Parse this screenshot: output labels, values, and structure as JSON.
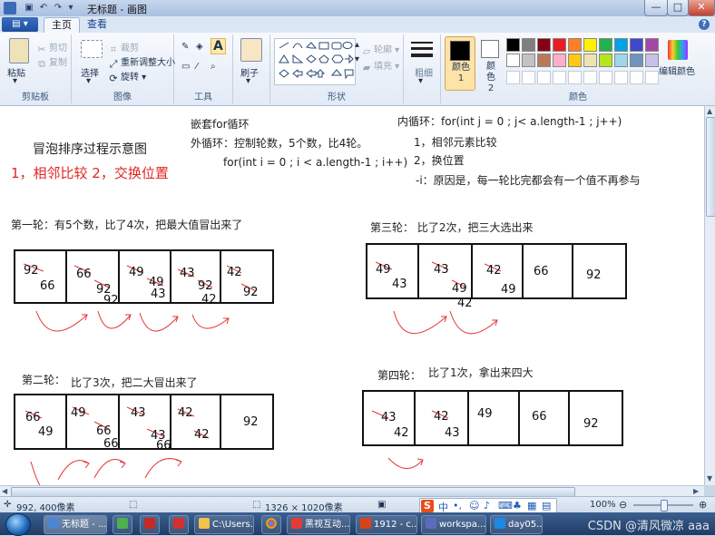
{
  "window": {
    "title": "无标题 - 画图",
    "controls": {
      "minimize": "—",
      "maximize": "□",
      "close": "✕"
    }
  },
  "tabs": [
    {
      "label": "主页",
      "active": true
    },
    {
      "label": "查看",
      "active": false
    }
  ],
  "ribbon": {
    "clipboard": {
      "label": "剪贴板",
      "paste": "粘贴",
      "cut": "剪切",
      "copy": "复制"
    },
    "image": {
      "label": "图像",
      "select": "选择",
      "crop": "裁剪",
      "resize": "重新调整大小",
      "rotate": "旋转"
    },
    "tools": {
      "label": "工具"
    },
    "brushes": {
      "label": "刷子"
    },
    "shapes": {
      "label": "形状",
      "outline": "轮廓",
      "fill": "填充"
    },
    "size": {
      "label": "粗细"
    },
    "colors": {
      "label": "颜色",
      "color1": "颜色 1",
      "color2": "颜色 2",
      "edit": "编辑颜色",
      "palette_row1": [
        "#000000",
        "#7f7f7f",
        "#880015",
        "#ed1c24",
        "#ff7f27",
        "#fff200",
        "#22b14c",
        "#00a2e8",
        "#3f48cc",
        "#a349a4"
      ],
      "palette_row2": [
        "#ffffff",
        "#c3c3c3",
        "#b97a57",
        "#ffaec9",
        "#ffc90e",
        "#efe4b0",
        "#b5e61d",
        "#99d9ea",
        "#7092be",
        "#c8bfe7"
      ]
    }
  },
  "canvas": {
    "title": "冒泡排序过程示意图",
    "subtitle": "1，相邻比较 2，交换位置",
    "nested": {
      "head": "嵌套for循环",
      "outer": "外循环：控制轮数，5个数，比4轮。",
      "outer_code": "for(int i = 0 ; i < a.length-1 ; i++)"
    },
    "inner": {
      "code": "内循环：for(int j = 0 ; j< a.length-1 ; j++)",
      "step1": "1，相邻元素比较",
      "step2": "2，换位置",
      "note": "-i：原因是，每一轮比完都会有一个值不再参与"
    },
    "rounds": {
      "r1": {
        "label": "第一轮：有5个数，比了4次，把最大值冒出来了",
        "nums": [
          "92",
          "66",
          "66",
          "92",
          "49",
          "49",
          "92",
          "43",
          "43",
          "92",
          "42",
          "42",
          "92"
        ]
      },
      "r2": {
        "label_a": "第二轮：",
        "label_b": "比了3次，把二大冒出来了",
        "nums": [
          "66",
          "49",
          "49",
          "66",
          "43",
          "43",
          "66",
          "42",
          "42",
          "66",
          "92"
        ]
      },
      "r3": {
        "label": "第三轮：  比了2次，把三大选出来",
        "nums": [
          "49",
          "43",
          "43",
          "49",
          "42",
          "42",
          "49",
          "66",
          "92"
        ]
      },
      "r4": {
        "label_a": "第四轮：",
        "label_b": "比了1次，拿出来四大",
        "nums": [
          "43",
          "42",
          "42",
          "43",
          "49",
          "66",
          "92"
        ]
      }
    }
  },
  "status": {
    "cursor": "992, 400像素",
    "canvas_size": "1326 × 1020像素",
    "zoom": "100%",
    "ime_char": "中"
  },
  "taskbar": {
    "items": [
      "无标题 - ...",
      "C:\\Users...",
      "黑视互动...",
      "1912 - c...",
      "workspa...",
      "day05..."
    ],
    "watermark": "CSDN @清风微凉 aaa"
  }
}
